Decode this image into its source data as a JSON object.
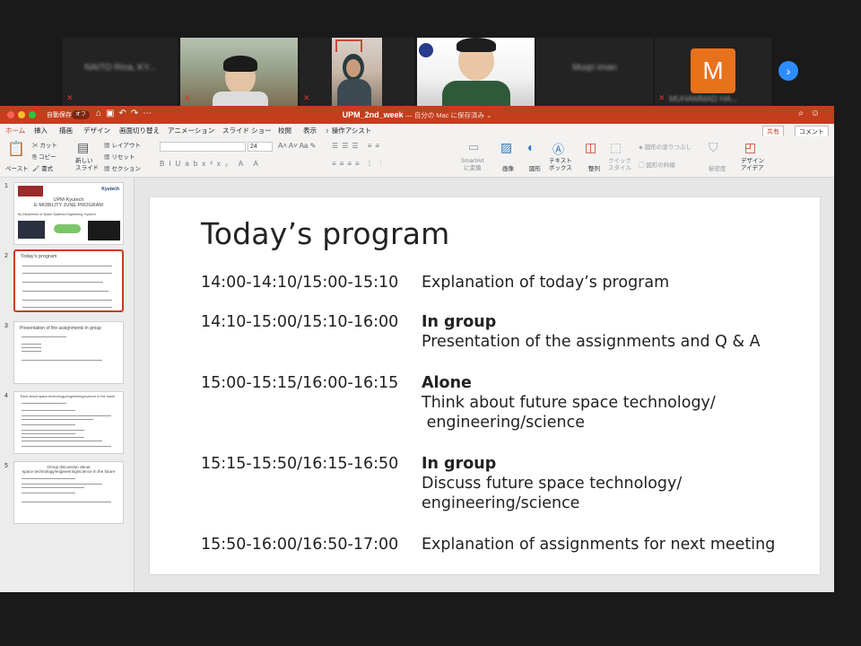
{
  "gallery": {
    "participants": [
      {
        "name": "NAITO Rina, KY..."
      },
      {
        "name": ""
      },
      {
        "name": ""
      },
      {
        "name": ""
      },
      {
        "name": "Muqri iman"
      },
      {
        "name": "M",
        "initial": "M",
        "bottom_name": "MUHAMMAD HA..."
      }
    ],
    "next_icon": "chevron-right-icon"
  },
  "window": {
    "autosave_label": "自動保存",
    "autosave_state": "オフ",
    "doc_title": "UPM_2nd_week",
    "doc_subtitle": "— 自分の Mac に保存済み ⌄"
  },
  "tabs": [
    "ホーム",
    "挿入",
    "描画",
    "デザイン",
    "画面切り替え",
    "アニメーション",
    "スライド ショー",
    "校閲",
    "表示",
    "操作アシスト"
  ],
  "share_label": "共有",
  "comment_label": "コメント",
  "ribbon": {
    "paste": "ペースト",
    "cut": "カット",
    "copy": "コピー",
    "format": "書式",
    "new_slide": "新しい\nスライド",
    "layout": "レイアウト",
    "reset": "リセット",
    "section": "セクション",
    "font_size": "24",
    "smartart": "SmartArt\nに変換",
    "image": "画像",
    "shapes": "図形",
    "textbox": "テキスト\nボックス",
    "arrange": "整列",
    "quick_styles": "クイック\nスタイル",
    "shape_fill": "図形の塗りつぶし",
    "shape_outline": "図形の枠線",
    "sensitivity": "秘密度",
    "design_ideas": "デザイン\nアイデア"
  },
  "thumbnails": [
    {
      "num": "1",
      "title": "UPM-Kyutech\nE-MOBILITY JUNE PROGRAM",
      "sub": "By Department of Space Systems Engineering, Kyutech",
      "logo": "Kyutech"
    },
    {
      "num": "2",
      "title": "Today's program"
    },
    {
      "num": "3",
      "title": "Presentation of the assignments in group"
    },
    {
      "num": "4",
      "title": "Think about space technology/engineering/science in the future"
    },
    {
      "num": "5",
      "title": "Group discussion about\nspace technology/engineering/science in the future"
    }
  ],
  "slide": {
    "title": "Today’s program",
    "rows": [
      {
        "time": "14:00-14:10/15:00-15:10",
        "heading": "",
        "text": [
          "Explanation of today’s program"
        ]
      },
      {
        "time": "14:10-15:00/15:10-16:00",
        "heading": "In group",
        "text": [
          "Presentation of the assignments and Q & A"
        ]
      },
      {
        "time": "15:00-15:15/16:00-16:15",
        "heading": "Alone",
        "text": [
          "Think about future space technology/",
          " engineering/science"
        ]
      },
      {
        "time": "15:15-15:50/16:15-16:50",
        "heading": "In group",
        "text": [
          "Discuss future space technology/",
          "engineering/science"
        ]
      },
      {
        "time": "15:50-16:00/16:50-17:00",
        "heading": "",
        "text": [
          "Explanation of assignments for next meeting"
        ]
      }
    ]
  }
}
